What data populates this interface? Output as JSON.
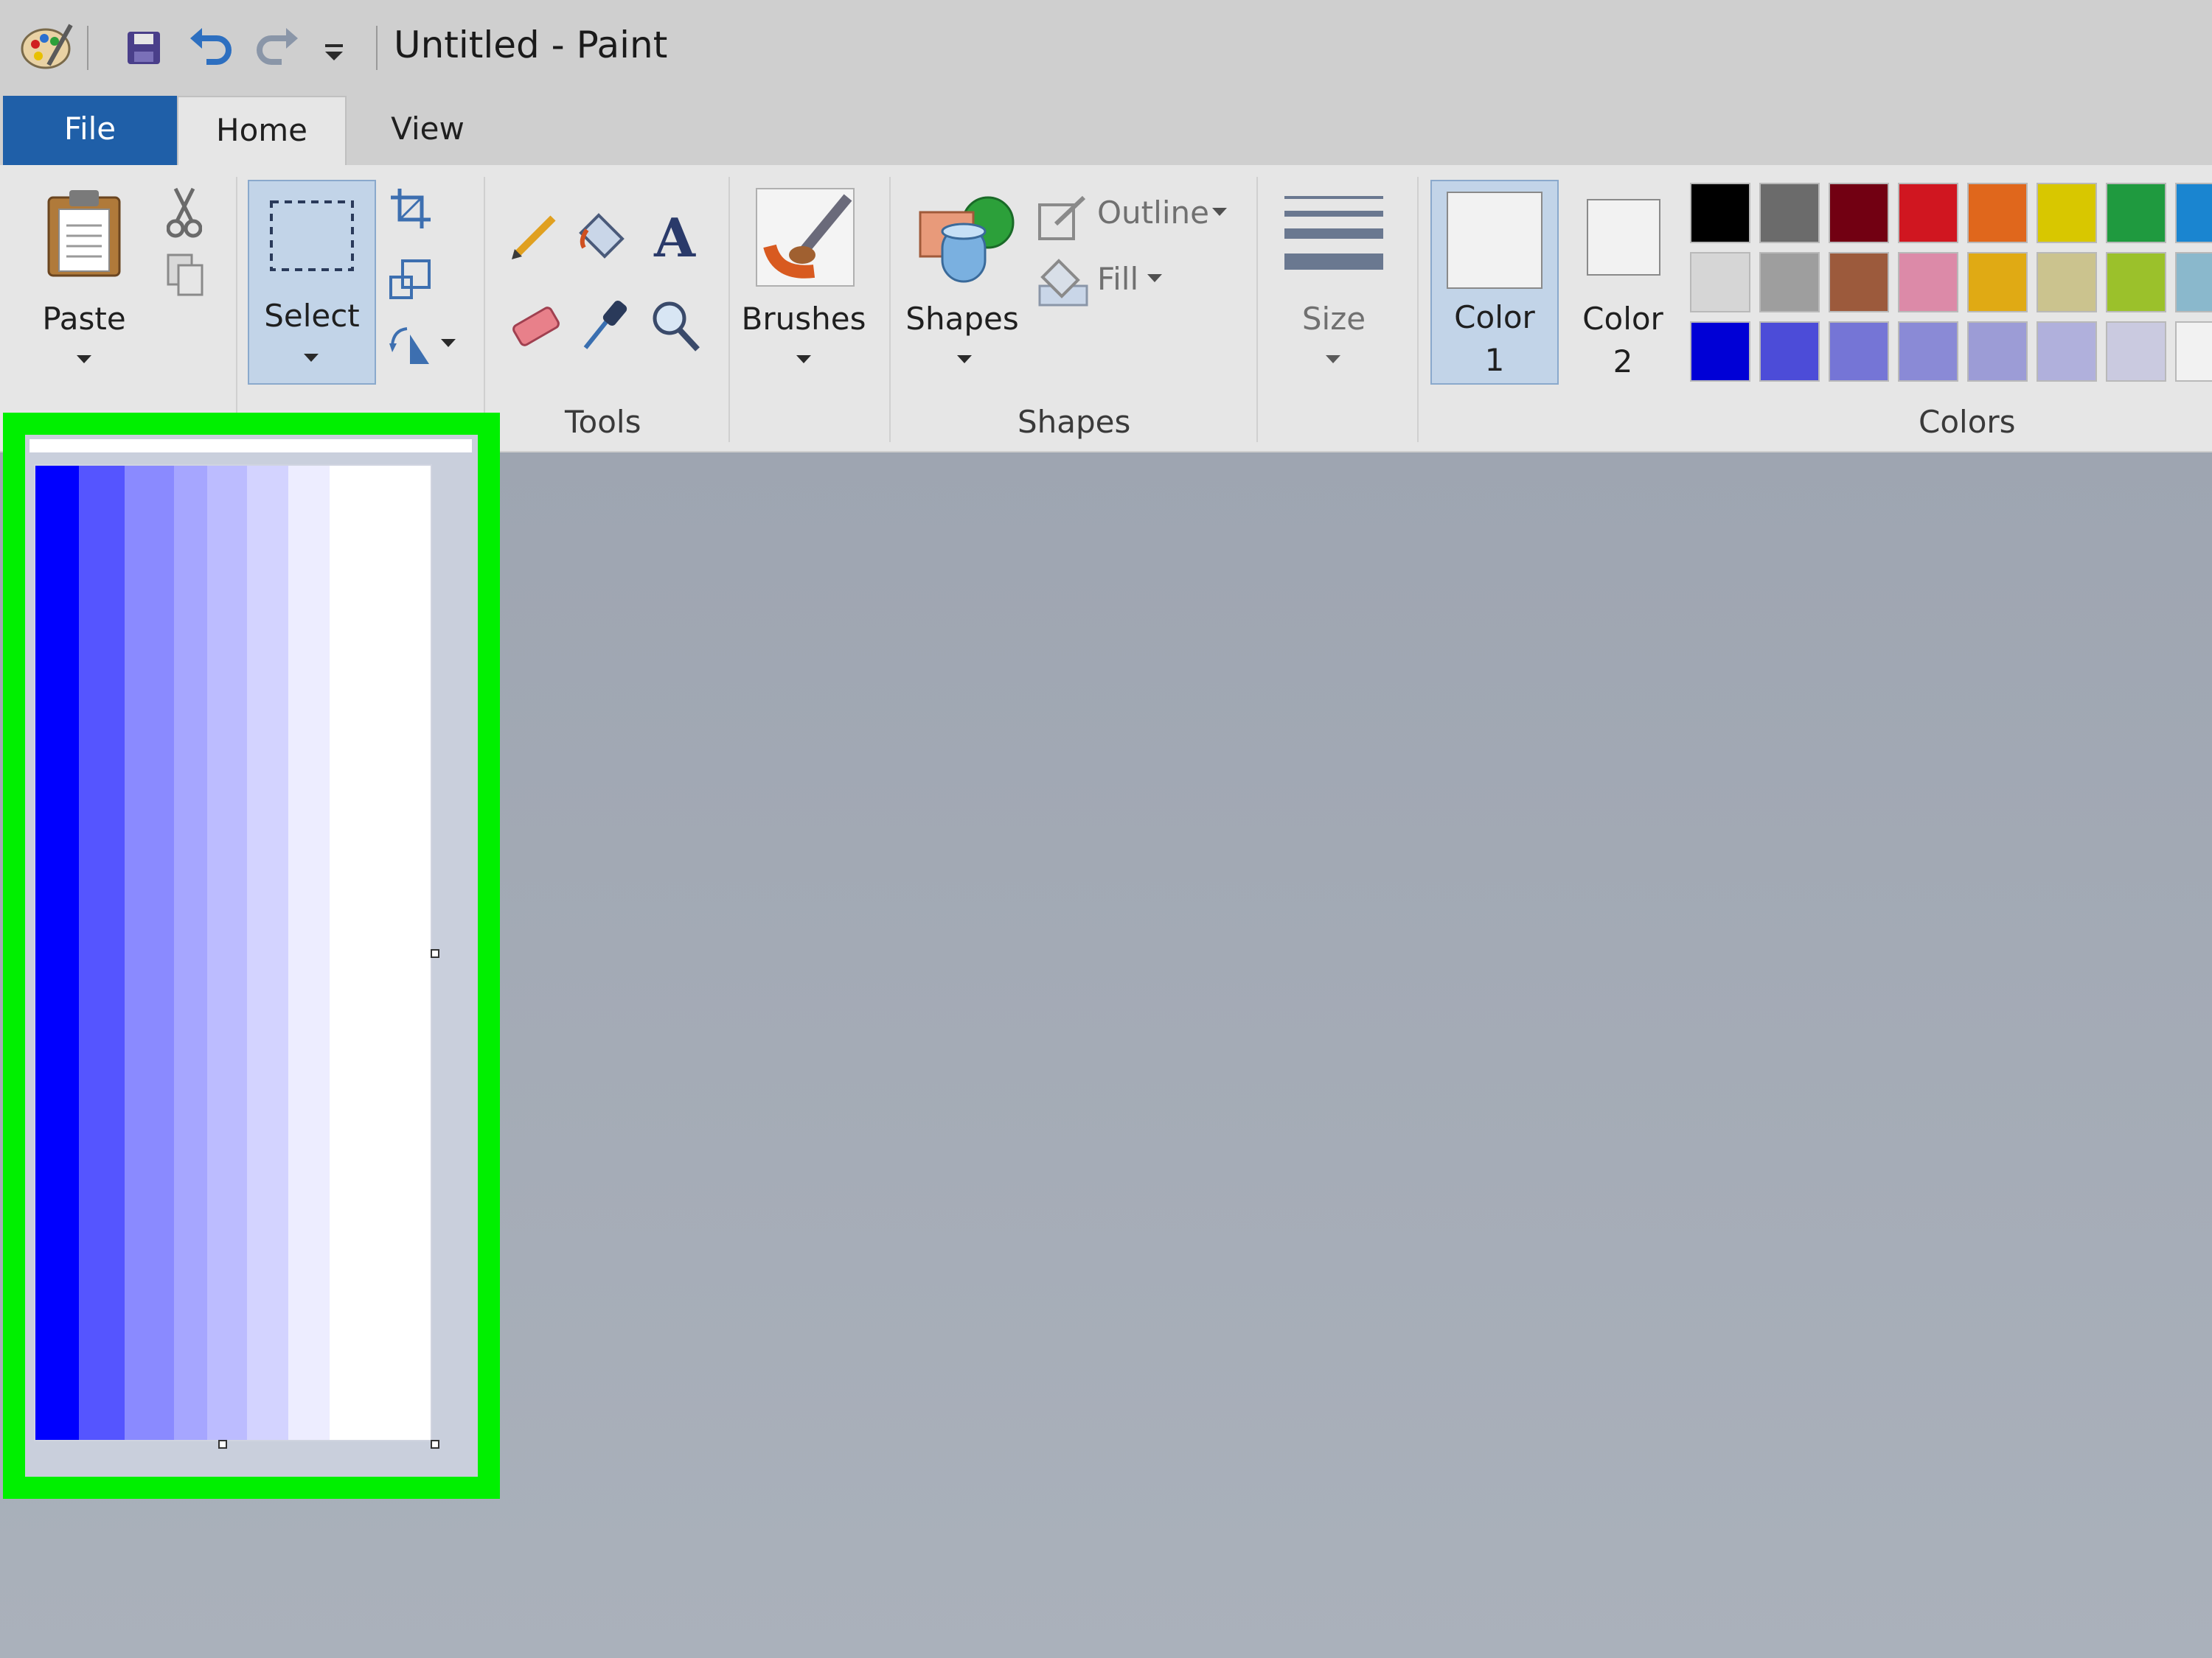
{
  "window": {
    "title": "Untitled - Paint"
  },
  "tabs": [
    {
      "label": "File"
    },
    {
      "label": "Home"
    },
    {
      "label": "View"
    }
  ],
  "ribbon": {
    "clipboard": {
      "paste_label": "Paste"
    },
    "image": {
      "select_label": "Select"
    },
    "tools": {
      "group_label": "Tools"
    },
    "brushes": {
      "label": "Brushes"
    },
    "shapes": {
      "label": "Shapes",
      "outline_label": "Outline",
      "fill_label": "Fill",
      "group_label": "Shapes"
    },
    "size": {
      "label": "Size"
    },
    "colors": {
      "color1_label": "Color",
      "color1_num": "1",
      "color2_label": "Color",
      "color2_num": "2",
      "group_label": "Colors",
      "palette": [
        [
          "#000000",
          "#6b6b6b",
          "#720012",
          "#d01620",
          "#e0671c",
          "#d8c700",
          "#1f9a3f",
          "#1a85d0"
        ],
        [
          "#d6d6d6",
          "#9e9e9e",
          "#9c5a3c",
          "#dc8aa8",
          "#e0aa14",
          "#cbc38e",
          "#9bc12b",
          "#8ab8cc"
        ],
        [
          "#0000d6",
          "#4c4cd8",
          "#7575d6",
          "#8a8ad6",
          "#9c9cd6",
          "#b0b0dc",
          "#cacae0",
          "#f2f2f2"
        ]
      ]
    }
  },
  "canvas": {
    "stripes": [
      {
        "color": "#0000ff",
        "share": 0.11
      },
      {
        "color": "#5555ff",
        "share": 0.115
      },
      {
        "color": "#8a8aff",
        "share": 0.125
      },
      {
        "color": "#a6a6ff",
        "share": 0.085
      },
      {
        "color": "#bcbcff",
        "share": 0.1
      },
      {
        "color": "#d3d3ff",
        "share": 0.105
      },
      {
        "color": "#ededff",
        "share": 0.105
      },
      {
        "color": "#ffffff",
        "share": 0.255
      }
    ],
    "highlight_color": "#00f000"
  }
}
